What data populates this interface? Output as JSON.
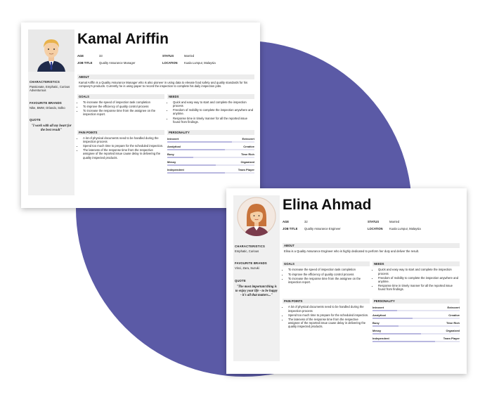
{
  "colors": {
    "accent": "#5b5aa6",
    "bar": "#b9b8e0"
  },
  "personas": [
    {
      "name": "Kamal Ariffin",
      "avatar_icon": "male-avatar-icon",
      "labels": {
        "age": "AGE",
        "job": "JOB TITLE",
        "status": "STATUS",
        "location": "LOCATION"
      },
      "age": "33",
      "job_title": "Quality Assurance Manager",
      "status": "Married",
      "location": "Kuala Lumpur, Malaysia",
      "characteristics_h": "CHARACTERISTICS",
      "characteristics": "Passionate, Emphatic, Curious Adventurous",
      "brands_h": "FAVOURITE BRANDS",
      "brands": "Nike, BMW, Orlando, Solko",
      "quote_h": "QUOTE",
      "quote": "\"I work with all my heart for the best result\"",
      "about_h": "ABOUT",
      "about": "Kamal Ariffin is a Quality Assurance Manager who is also pioneer in using data to elevate food safety and quality standards for his company's products. Currently he is using paper to record the inspection to complete his daily inspection jobs.",
      "goals_h": "GOALS",
      "goals": [
        "To increase the speed of inspection task completion",
        "To improve the efficiency of quality control process",
        "To increase the response time from the assignee on the inspection report."
      ],
      "needs_h": "NEEDS",
      "needs": [
        "Quick and easy way to start and complete the inspection process",
        "Freedom of mobility to complete the inspection anywhere and anytime.",
        "Response time in timely manner for all the reported issue found from findings."
      ],
      "pain_h": "PAIN POINTS",
      "pain": [
        "A lot of physical documents need to be handled during the inspection process",
        "Spend too much time to prepare for the scheduled inspection.",
        "The lateness of the response time from the respective assignee of the reported issue cause delay in delivering the quality inspected products."
      ],
      "personality_h": "PERSONALITY",
      "personality": [
        {
          "left": "Introvert",
          "right": "Extrovert",
          "value": 0.74
        },
        {
          "left": "Analytical",
          "right": "Creative",
          "value": 0.66
        },
        {
          "left": "Busy",
          "right": "Time Rich",
          "value": 0.3
        },
        {
          "left": "Messy",
          "right": "Organized",
          "value": 0.56
        },
        {
          "left": "Independent",
          "right": "Team Player",
          "value": 0.66
        }
      ]
    },
    {
      "name": "Elina Ahmad",
      "avatar_icon": "female-avatar-icon",
      "labels": {
        "age": "AGE",
        "job": "JOB TITLE",
        "status": "STATUS",
        "location": "LOCATION"
      },
      "age": "32",
      "job_title": "Quality Assurance Engineer",
      "status": "Married",
      "location": "Kuala Lumpur, Malaysia",
      "characteristics_h": "CHARACTERISTICS",
      "characteristics": "Emphatic, Curious",
      "brands_h": "FAVOURITE BRANDS",
      "brands": "Vinci, Zara, Suzuki",
      "quote_h": "QUOTE",
      "quote": "\"The most important thing is to enjoy your life - to be happy - it's all that matters...\"",
      "about_h": "ABOUT",
      "about": "Elina is a Quality Assurance Engineer who is highly dedicated to perform her duty and deliver the result.",
      "goals_h": "GOALS",
      "goals": [
        "To increase the speed of inspection task completion",
        "To improve the efficiency of quality control process",
        "To increase the response time from the assignee on the inspection report."
      ],
      "needs_h": "NEEDS",
      "needs": [
        "Quick and easy way to start and complete the inspection process",
        "Freedom of mobility to complete the inspection anywhere and anytime.",
        "Response time in timely manner for all the reported issue found from findings."
      ],
      "pain_h": "PAIN POINTS",
      "pain": [
        "A lot of physical documents need to be handled during the inspection process",
        "Spend too much time to prepare for the scheduled inspection.",
        "The lateness of the response time from the respective assignee of the reported issue cause delay in delivering the quality inspected products."
      ],
      "personality_h": "PERSONALITY",
      "personality": [
        {
          "left": "Introvert",
          "right": "Extrovert",
          "value": 0.28
        },
        {
          "left": "Analytical",
          "right": "Creative",
          "value": 0.46
        },
        {
          "left": "Busy",
          "right": "Time Rich",
          "value": 0.3
        },
        {
          "left": "Messy",
          "right": "Organized",
          "value": 0.56
        },
        {
          "left": "Independent",
          "right": "Team Player",
          "value": 0.72
        }
      ]
    }
  ]
}
